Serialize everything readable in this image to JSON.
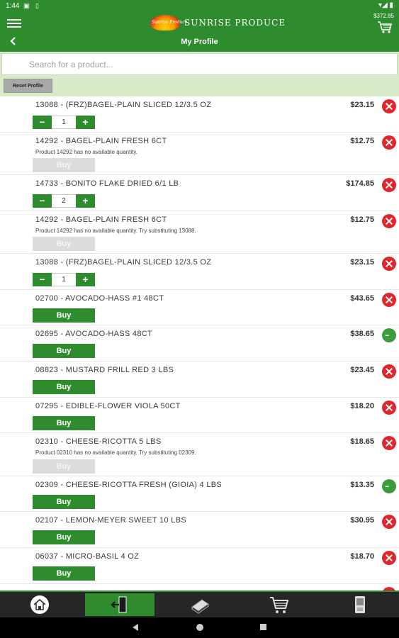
{
  "status_bar": {
    "time": "1:44"
  },
  "header": {
    "brand": "SUNRISE PRODUCE",
    "logo_script": "Sunrise Produce",
    "cart_total": "$372.85",
    "title": "My Profile"
  },
  "search": {
    "placeholder": "Search for a product..."
  },
  "reset_label": "Reset Profile",
  "buy_label": "Buy",
  "items": [
    {
      "name": "13088 - (FRZ)BAGEL-PLAIN SLICED 12/3.5 OZ",
      "price": "$23.15",
      "qty": "1",
      "msg": ""
    },
    {
      "name": "14292 - BAGEL-PLAIN FRESH 6CT",
      "price": "$12.75",
      "qty": "",
      "msg": "Product 14292 has no available quantity."
    },
    {
      "name": "14733 - BONITO FLAKE DRIED 6/1 LB",
      "price": "$174.85",
      "qty": "2",
      "msg": ""
    },
    {
      "name": "14292 - BAGEL-PLAIN FRESH 6CT",
      "price": "$12.75",
      "qty": "",
      "msg": "Product 14292 has no available quantity.  Try substituting 13088."
    },
    {
      "name": "13088 - (FRZ)BAGEL-PLAIN SLICED 12/3.5 OZ",
      "price": "$23.15",
      "qty": "1",
      "msg": ""
    },
    {
      "name": "02700 - AVOCADO-HASS #1 48CT",
      "price": "$43.65",
      "qty": "",
      "msg": ""
    },
    {
      "name": "02695 - AVOCADO-HASS 48CT",
      "price": "$38.65",
      "qty": "",
      "msg": ""
    },
    {
      "name": "08823 - MUSTARD FRILL RED 3 LBS",
      "price": "$23.45",
      "qty": "",
      "msg": ""
    },
    {
      "name": "07295 - EDIBLE-FLOWER VIOLA 50CT",
      "price": "$18.20",
      "qty": "",
      "msg": ""
    },
    {
      "name": "02310 - CHEESE-RICOTTA 5 LBS",
      "price": "$18.65",
      "qty": "",
      "msg": "Product 02310 has no available quantity.  Try substituting 02309."
    },
    {
      "name": "02309 - CHEESE-RICOTTA FRESH (GIOIA) 4 LBS",
      "price": "$13.35",
      "qty": "",
      "msg": ""
    },
    {
      "name": "02107 - LEMON-MEYER SWEET 10 LBS",
      "price": "$30.95",
      "qty": "",
      "msg": ""
    },
    {
      "name": "06037 - MICRO-BASIL 4 OZ",
      "price": "$18.70",
      "qty": "",
      "msg": ""
    }
  ],
  "stepper_minus": "−",
  "stepper_plus": "+",
  "icons": {
    "menu": "menu-icon",
    "cart": "cart-icon",
    "back": "back-arrow-icon",
    "remove": "remove-icon",
    "more": "more-icon",
    "home": "home-icon",
    "logout": "logout-icon",
    "catalog": "catalog-icon",
    "cart_nav": "cart-icon",
    "phone": "phone-icon"
  },
  "colors": {
    "primary_green": "#2e8b2e",
    "remove_red": "#e0262b",
    "light_green": "#d8ebc9"
  }
}
